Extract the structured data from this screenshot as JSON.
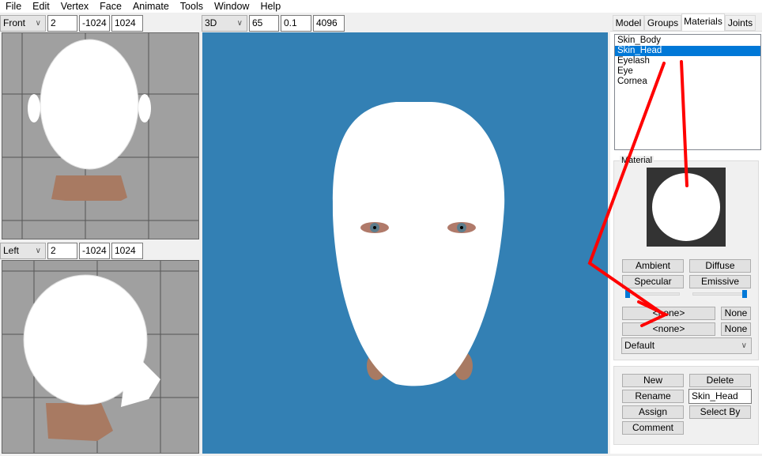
{
  "menu": [
    "File",
    "Edit",
    "Vertex",
    "Face",
    "Animate",
    "Tools",
    "Window",
    "Help"
  ],
  "front_view": {
    "mode": "Front",
    "a": "2",
    "b": "-1024",
    "c": "1024"
  },
  "left_view": {
    "mode": "Left",
    "a": "2",
    "b": "-1024",
    "c": "1024"
  },
  "view_3d": {
    "mode": "3D",
    "a": "65",
    "b": "0.1",
    "c": "4096",
    "background": "#3380b4"
  },
  "tabs": [
    "Model",
    "Groups",
    "Materials",
    "Joints"
  ],
  "active_tab": "Materials",
  "materials": [
    "Skin_Body",
    "Skin_Head",
    "Eyelash",
    "Eye",
    "Cornea"
  ],
  "selected_material": "Skin_Head",
  "material_group_label": "Material",
  "buttons": {
    "ambient": "Ambient",
    "diffuse": "Diffuse",
    "specular": "Specular",
    "emissive": "Emissive",
    "tex1": "<none>",
    "tex1_none": "None",
    "tex2": "<none>",
    "tex2_none": "None",
    "new": "New",
    "delete": "Delete",
    "rename": "Rename",
    "assign": "Assign",
    "select_by": "Select By",
    "comment": "Comment"
  },
  "blend_mode": "Default",
  "rename_value": "Skin_Head",
  "sliders": {
    "shininess": 0,
    "transparency": 1
  },
  "accent": "#0078d7",
  "annotation_color": "#ff0000"
}
